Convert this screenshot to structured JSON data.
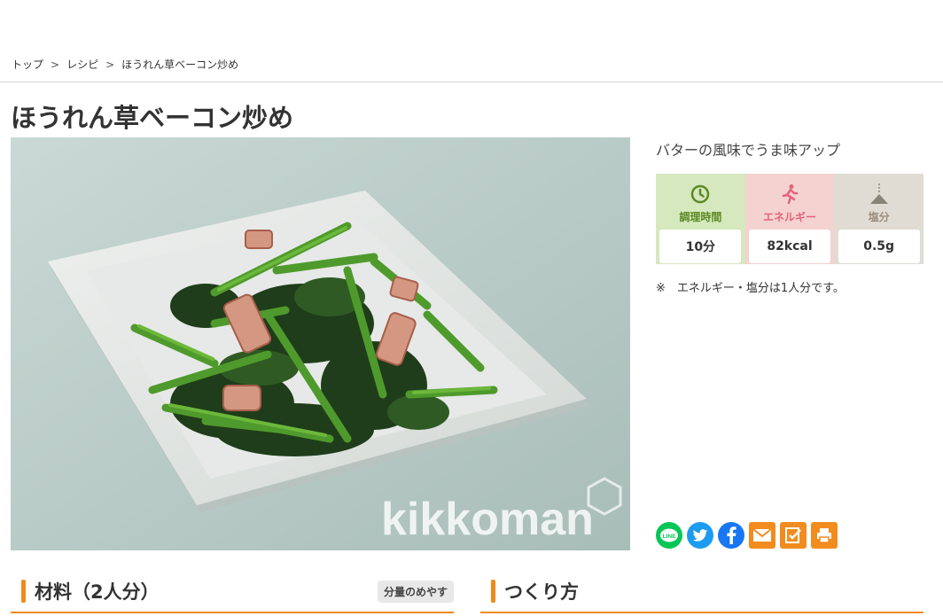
{
  "breadcrumb": {
    "items": [
      "トップ",
      "レシピ",
      "ほうれん草ベーコン炒め"
    ],
    "separator": ">"
  },
  "recipe": {
    "title": "ほうれん草ベーコン炒め",
    "catchphrase": "バターの風味でうま味アップ",
    "photo_watermark": "kikkoman"
  },
  "nutrition": {
    "time": {
      "label": "調理時間",
      "value": "10分",
      "icon": "clock-icon",
      "color": "#5c8a23"
    },
    "energy": {
      "label": "エネルギー",
      "value": "82kcal",
      "icon": "running-person-icon",
      "color": "#e3647b"
    },
    "salt": {
      "label": "塩分",
      "value": "0.5g",
      "icon": "salt-pile-icon",
      "color": "#9a8f80"
    },
    "note": "※　エネルギー・塩分は1人分です。"
  },
  "share": {
    "buttons": [
      "line-icon",
      "twitter-icon",
      "facebook-icon",
      "mail-icon",
      "save-icon",
      "print-icon"
    ],
    "colors": {
      "line": "#06c755",
      "twitter": "#1d9bf0",
      "facebook": "#1877f2",
      "orange": "#f28c1e"
    }
  },
  "sections": {
    "ingredients": {
      "title": "材料（2人分）",
      "serving_guide_button": "分量のめやす"
    },
    "steps": {
      "title": "つくり方"
    }
  },
  "accent_color": "#f08a1c"
}
